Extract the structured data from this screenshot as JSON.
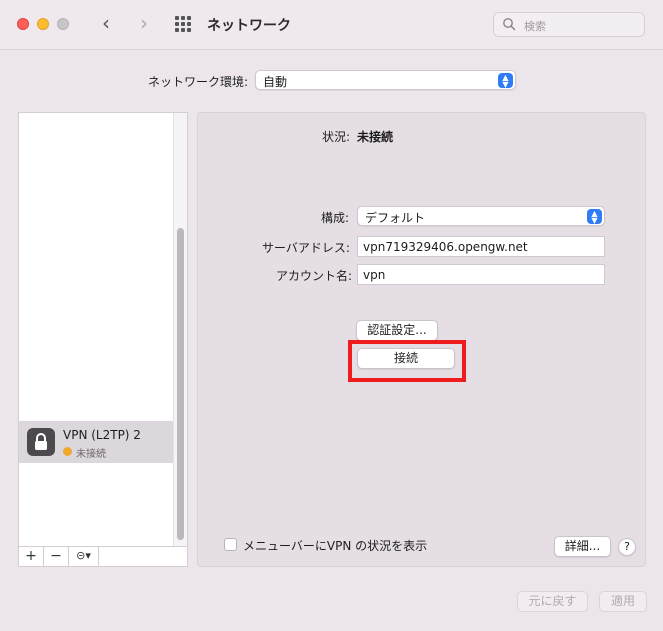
{
  "window": {
    "title": "ネットワーク",
    "search_placeholder": "検索"
  },
  "location": {
    "label": "ネットワーク環境:",
    "value": "自動"
  },
  "sidebar": {
    "items": [
      {
        "name": "VPN (L2TP) 2",
        "status": "未接続",
        "status_color": "#f0a92c",
        "icon": "lock-icon"
      }
    ],
    "toolbar": {
      "add": "+",
      "remove": "−",
      "action": "⊝▾"
    }
  },
  "detail": {
    "status_label": "状況:",
    "status_value": "未接続",
    "config_label": "構成:",
    "config_value": "デフォルト",
    "server_label": "サーバアドレス:",
    "server_value": "vpn719329406.opengw.net",
    "account_label": "アカウント名:",
    "account_value": "vpn",
    "auth_button": "認証設定...",
    "connect_button": "接続",
    "menubar_checkbox_label": "メニューバーにVPN の状況を表示",
    "menubar_checkbox_checked": false,
    "advanced_button": "詳細...",
    "help_button": "?"
  },
  "footer": {
    "revert_button": "元に戻す",
    "apply_button": "適用"
  },
  "colors": {
    "accent": "#2f7cf6",
    "highlight": "#ee1c1c"
  }
}
